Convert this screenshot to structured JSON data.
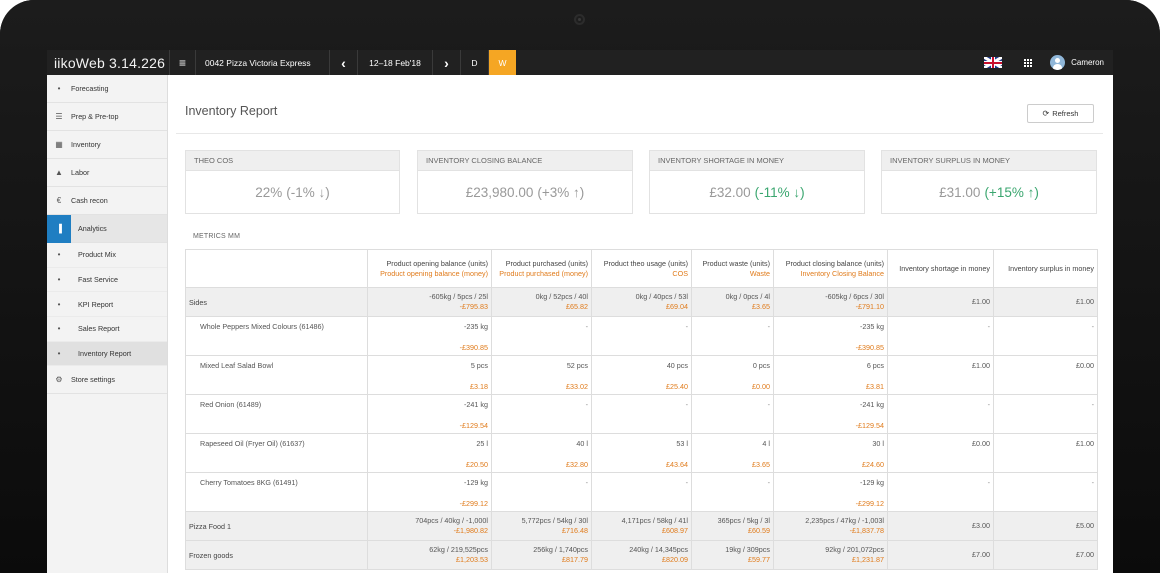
{
  "topbar": {
    "brand": "iikoWeb 3.14.226",
    "store": "0042 Pizza Victoria Express",
    "prev_icon": "‹",
    "date_range": "12–18 Feb'18",
    "next_icon": "›",
    "day_label": "D",
    "week_label": "W",
    "user_name": "Cameron",
    "menu_icon": "≡"
  },
  "sidebar": {
    "items": [
      {
        "label": "Forecasting",
        "icon": "lightbulb-icon",
        "glyph": "•"
      },
      {
        "label": "Prep & Pre-top",
        "icon": "list-icon",
        "glyph": "☰"
      },
      {
        "label": "Inventory",
        "icon": "calculator-icon",
        "glyph": "▦"
      },
      {
        "label": "Labor",
        "icon": "person-icon",
        "glyph": "▲"
      },
      {
        "label": "Cash recon",
        "icon": "euro-icon",
        "glyph": "€"
      },
      {
        "label": "Analytics",
        "icon": "bar-chart-icon",
        "glyph": "▐"
      }
    ],
    "sub_items": [
      {
        "label": "Product Mix"
      },
      {
        "label": "Fast Service"
      },
      {
        "label": "KPI Report"
      },
      {
        "label": "Sales Report"
      },
      {
        "label": "Inventory Report"
      }
    ],
    "bottom_item": {
      "label": "Store settings",
      "icon": "gear-icon",
      "glyph": "⚙"
    }
  },
  "page": {
    "title": "Inventory Report",
    "refresh_label": "Refresh",
    "metrics_label": "METRICS MM"
  },
  "kpis": [
    {
      "label": "THEO COS",
      "value": "22%",
      "change": "(-1% ↓)",
      "status": "neutral"
    },
    {
      "label": "INVENTORY CLOSING BALANCE",
      "value": "£23,980.00",
      "change": "(+3% ↑)",
      "status": "neutral"
    },
    {
      "label": "INVENTORY SHORTAGE IN MONEY",
      "value": "£32.00",
      "change": "(-11% ↓)",
      "status": "good"
    },
    {
      "label": "INVENTORY SURPLUS IN MONEY",
      "value": "£31.00",
      "change": "(+15% ↑)",
      "status": "good"
    }
  ],
  "table": {
    "headers": [
      {
        "main": "",
        "sub": ""
      },
      {
        "main": "Product opening balance (units)",
        "sub": "Product opening balance (money)"
      },
      {
        "main": "Product purchased (units)",
        "sub": "Product purchased (money)"
      },
      {
        "main": "Product theo usage (units)",
        "sub": "COS"
      },
      {
        "main": "Product waste (units)",
        "sub": "Waste"
      },
      {
        "main": "Product closing balance (units)",
        "sub": "Inventory Closing Balance"
      },
      {
        "main": "Inventory shortage in money",
        "sub": ""
      },
      {
        "main": "Inventory surplus in money",
        "sub": ""
      }
    ],
    "rows": [
      {
        "type": "group",
        "name": "Sides",
        "cells": [
          [
            "-605kg / 5pcs / 25l",
            "-£795.83"
          ],
          [
            "0kg / 52pcs / 40l",
            "£65.82"
          ],
          [
            "0kg / 40pcs / 53l",
            "£69.04"
          ],
          [
            "0kg / 0pcs / 4l",
            "£3.65"
          ],
          [
            "-605kg / 6pcs / 30l",
            "-£791.10"
          ]
        ],
        "shortage": "£1.00",
        "surplus": "£1.00"
      },
      {
        "type": "item",
        "name": "Whole Peppers Mixed Colours (61486)",
        "cells": [
          [
            "-235 kg",
            "-£390.85"
          ],
          [
            "-",
            ""
          ],
          [
            "-",
            ""
          ],
          [
            "-",
            ""
          ],
          [
            "-235 kg",
            "-£390.85"
          ]
        ],
        "shortage": "-",
        "surplus": "-"
      },
      {
        "type": "item",
        "name": "Mixed Leaf Salad Bowl",
        "cells": [
          [
            "5 pcs",
            "£3.18"
          ],
          [
            "52 pcs",
            "£33.02"
          ],
          [
            "40 pcs",
            "£25.40"
          ],
          [
            "0 pcs",
            "£0.00"
          ],
          [
            "6 pcs",
            "£3.81"
          ]
        ],
        "shortage": "£1.00",
        "surplus": "£0.00"
      },
      {
        "type": "item",
        "name": "Red Onion (61489)",
        "cells": [
          [
            "-241 kg",
            "-£129.54"
          ],
          [
            "-",
            ""
          ],
          [
            "-",
            ""
          ],
          [
            "-",
            ""
          ],
          [
            "-241 kg",
            "-£129.54"
          ]
        ],
        "shortage": "-",
        "surplus": "-"
      },
      {
        "type": "item",
        "name": "Rapeseed Oil (Fryer Oil) (61637)",
        "cells": [
          [
            "25 l",
            "£20.50"
          ],
          [
            "40 l",
            "£32.80"
          ],
          [
            "53 l",
            "£43.64"
          ],
          [
            "4 l",
            "£3.65"
          ],
          [
            "30 l",
            "£24.60"
          ]
        ],
        "shortage": "£0.00",
        "surplus": "£1.00"
      },
      {
        "type": "item",
        "name": "Cherry Tomatoes 8KG (61491)",
        "cells": [
          [
            "-129 kg",
            "-£299.12"
          ],
          [
            "-",
            ""
          ],
          [
            "-",
            ""
          ],
          [
            "-",
            ""
          ],
          [
            "-129 kg",
            "-£299.12"
          ]
        ],
        "shortage": "-",
        "surplus": "-"
      },
      {
        "type": "group",
        "name": "Pizza Food 1",
        "cells": [
          [
            "704pcs / 40kg / -1,000l",
            "-£1,980.82"
          ],
          [
            "5,772pcs / 54kg / 30l",
            "£716.48"
          ],
          [
            "4,171pcs / 58kg / 41l",
            "£608.97"
          ],
          [
            "365pcs / 5kg / 3l",
            "£60.59"
          ],
          [
            "2,235pcs / 47kg / -1,003l",
            "-£1,837.78"
          ]
        ],
        "shortage": "£3.00",
        "surplus": "£5.00"
      },
      {
        "type": "group",
        "name": "Frozen goods",
        "cells": [
          [
            "62kg / 219,525pcs",
            "£1,203.53"
          ],
          [
            "256kg / 1,740pcs",
            "£817.79"
          ],
          [
            "240kg / 14,345pcs",
            "£820.09"
          ],
          [
            "19kg / 309pcs",
            "£59.77"
          ],
          [
            "92kg / 201,072pcs",
            "£1,231.87"
          ]
        ],
        "shortage": "£7.00",
        "surplus": "£7.00"
      }
    ]
  },
  "colors": {
    "accent": "#f5a623",
    "money": "#e07b1b",
    "good": "#3aa66f",
    "analytics_icon_bg": "#1f7ec2"
  }
}
